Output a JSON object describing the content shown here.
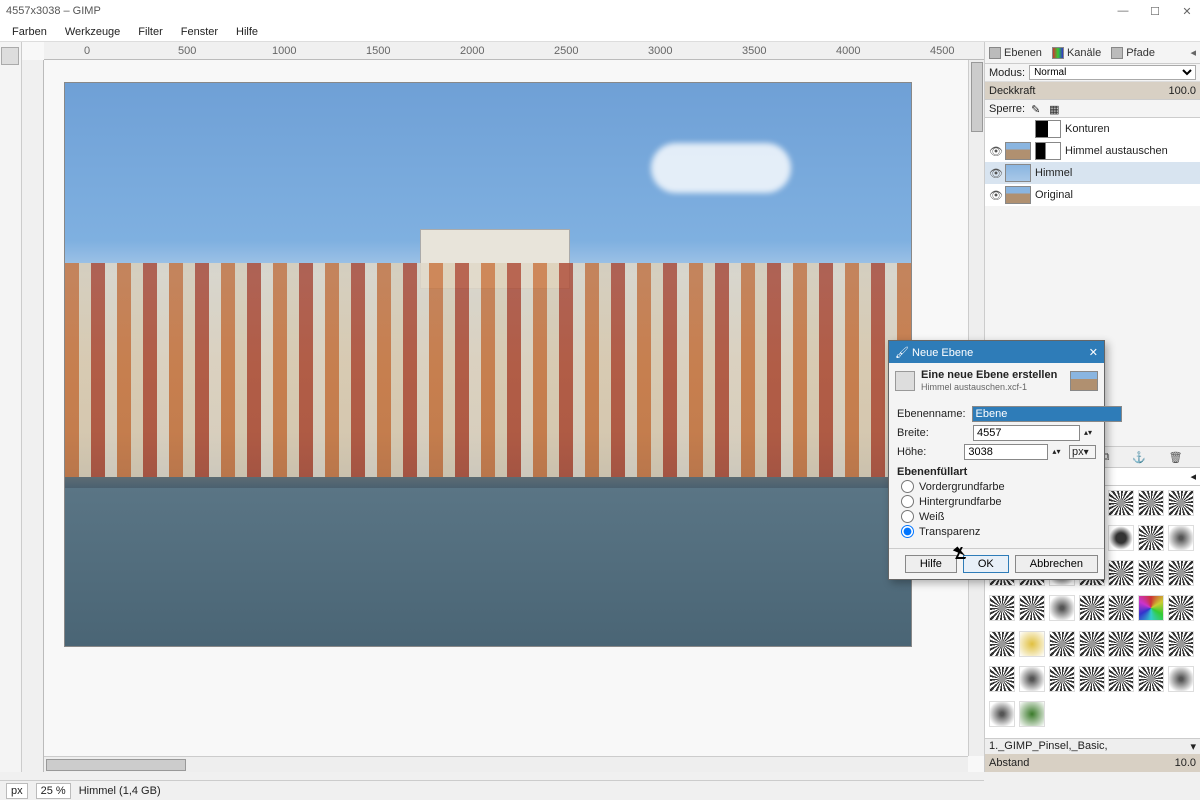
{
  "title": "4557x3038 – GIMP",
  "window_buttons": {
    "min": "—",
    "max": "☐",
    "close": "✕"
  },
  "menu": [
    "Farben",
    "Werkzeuge",
    "Filter",
    "Fenster",
    "Hilfe"
  ],
  "ruler_marks": [
    "0",
    "500",
    "1000",
    "1500",
    "2000",
    "2500",
    "3000",
    "3500",
    "4000",
    "4500"
  ],
  "dock": {
    "tabs": [
      {
        "label": "Ebenen",
        "icon": "layers-icon"
      },
      {
        "label": "Kanäle",
        "icon": "channels-icon"
      },
      {
        "label": "Pfade",
        "icon": "paths-icon"
      }
    ],
    "mode_label": "Modus:",
    "mode_value": "Normal",
    "opacity_label": "Deckkraft",
    "opacity_value": "100.0",
    "lock_label": "Sperre:",
    "layers": [
      {
        "name": "Konturen",
        "visible": false,
        "thumb": "bw"
      },
      {
        "name": "Himmel austauschen",
        "visible": true,
        "thumb": "img",
        "mask": true
      },
      {
        "name": "Himmel",
        "visible": true,
        "thumb": "sky",
        "selected": true
      },
      {
        "name": "Original",
        "visible": true,
        "thumb": "img"
      }
    ],
    "layer_action_icons": [
      "new-layer-icon",
      "raise-icon",
      "lower-icon",
      "duplicate-icon",
      "anchor-icon",
      "delete-icon"
    ],
    "brush_label": "1._GIMP_Pinsel,_Basic,",
    "brush_spacing_label": "Abstand",
    "brush_spacing_value": "10.0"
  },
  "status": {
    "unit": "px",
    "zoom": "25 %",
    "info": "Himmel (1,4 GB)"
  },
  "dialog": {
    "title": "Neue Ebene",
    "heading": "Eine neue Ebene erstellen",
    "subheading": "Himmel austauschen.xcf-1",
    "name_label": "Ebenenname:",
    "name_value": "Ebene",
    "width_label": "Breite:",
    "width_value": "4557",
    "height_label": "Höhe:",
    "height_value": "3038",
    "unit": "px",
    "fill_section": "Ebenenfüllart",
    "fill_options": [
      "Vordergrundfarbe",
      "Hintergrundfarbe",
      "Weiß",
      "Transparenz"
    ],
    "fill_selected": 3,
    "btn_help": "Hilfe",
    "btn_ok": "OK",
    "btn_cancel": "Abbrechen"
  }
}
